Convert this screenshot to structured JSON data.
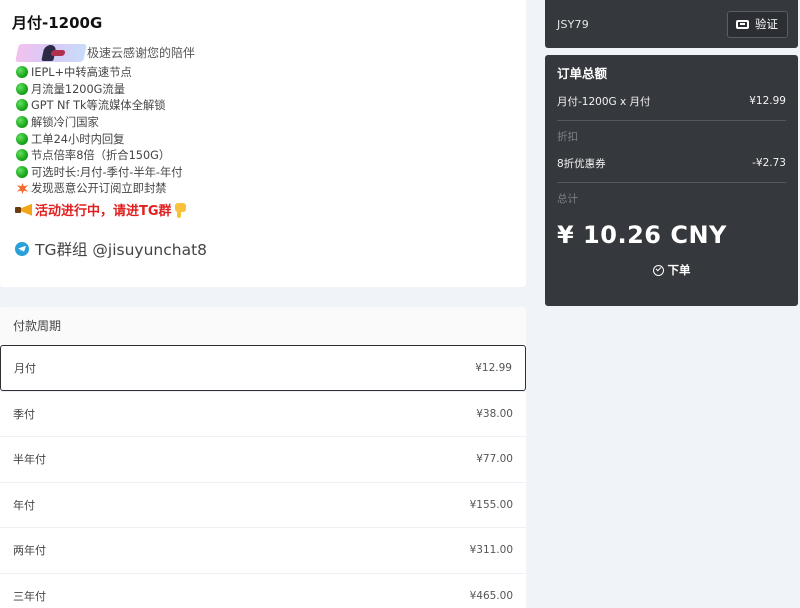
{
  "product": {
    "title": "月付-1200G",
    "banner_text": "极速云感谢您的陪伴",
    "features": [
      "IEPL+中转高速节点",
      "月流量1200G流量",
      "GPT Nf Tk等流媒体全解锁",
      "解锁冷门国家",
      "工单24小时内回复",
      "节点倍率8倍（折合150G）",
      "可选时长:月付-季付-半年-年付"
    ],
    "warning": "发现恶意公开订阅立即封禁",
    "promo": "活动进行中，请进TG群",
    "tg": "TG群组 @jisuyunchat8",
    "icons": {
      "feature": "green-circle-icon",
      "warning": "collision-icon",
      "promo": "megaphone-icon",
      "promo_end": "pointing-down-icon",
      "tg": "telegram-icon"
    }
  },
  "cycle": {
    "header": "付款周期",
    "items": [
      {
        "label": "月付",
        "price": "¥12.99",
        "selected": true
      },
      {
        "label": "季付",
        "price": "¥38.00"
      },
      {
        "label": "半年付",
        "price": "¥77.00"
      },
      {
        "label": "年付",
        "price": "¥155.00"
      },
      {
        "label": "两年付",
        "price": "¥311.00"
      },
      {
        "label": "三年付",
        "price": "¥465.00"
      }
    ]
  },
  "coupon": {
    "code": "JSY79",
    "verify_label": "验证"
  },
  "summary": {
    "title": "订单总额",
    "line_item": "月付-1200G x 月付",
    "line_price": "¥12.99",
    "discount_label": "折扣",
    "coupon_name": "8折优惠券",
    "coupon_amount": "-¥2.73",
    "total_label": "总计",
    "total": "¥ 10.26 CNY",
    "order_label": "下单"
  },
  "colors": {
    "dark_panel": "#35383c",
    "promo_red": "#e02020",
    "selected_border": "#2c2f34"
  }
}
